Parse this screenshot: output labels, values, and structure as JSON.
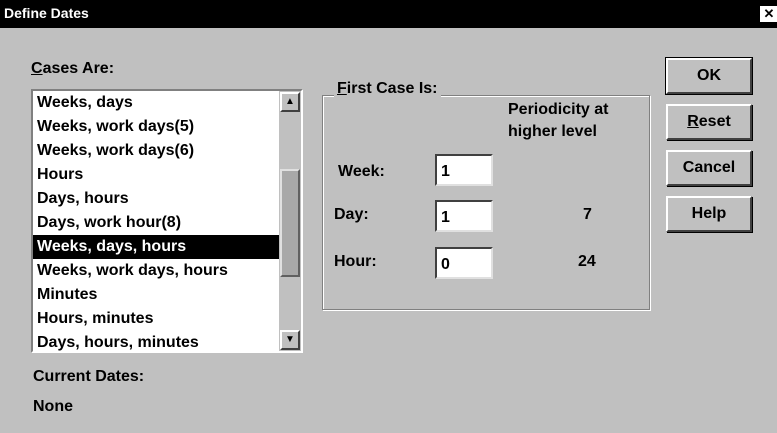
{
  "window": {
    "title": "Define Dates",
    "close_glyph": "✕"
  },
  "cases": {
    "label_prefix": "",
    "label_accel": "C",
    "label_rest": "ases Are:",
    "items": [
      "Weeks, days",
      "Weeks, work days(5)",
      "Weeks, work days(6)",
      "Hours",
      "Days, hours",
      "Days, work hour(8)",
      "Weeks, days, hours",
      "Weeks, work days, hours",
      "Minutes",
      "Hours, minutes",
      "Days, hours, minutes"
    ],
    "selected_index": 6
  },
  "first_case": {
    "title_accel": "F",
    "title_rest": "irst Case Is:",
    "periodicity_line1": "Periodicity at",
    "periodicity_line2": "higher level",
    "week_label": "Week:",
    "week_value": "1",
    "day_label": "Day:",
    "day_value": "1",
    "day_periodicity": "7",
    "hour_label": "Hour:",
    "hour_value": "0",
    "hour_periodicity": "24"
  },
  "current_dates": {
    "label": "Current Dates:",
    "value": "None"
  },
  "buttons": {
    "ok": "OK",
    "reset_accel": "R",
    "reset_rest": "eset",
    "cancel": "Cancel",
    "help": "Help"
  },
  "icons": {
    "scroll_up": "▲",
    "scroll_down": "▼"
  }
}
